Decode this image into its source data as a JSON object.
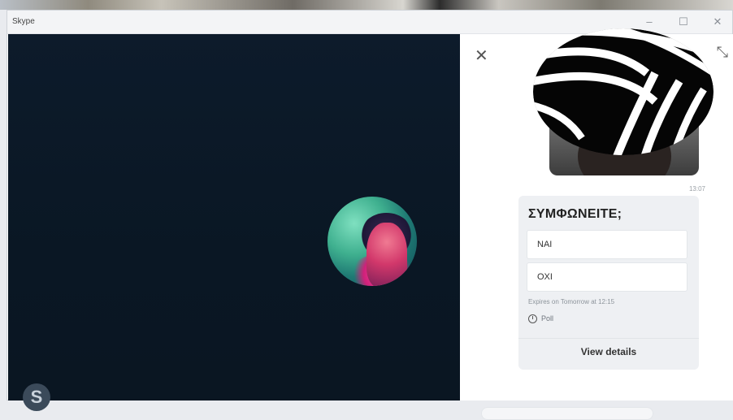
{
  "window": {
    "title": "Skype",
    "minimize_symbol": "–",
    "maximize_symbol": "☐",
    "close_symbol": "✕"
  },
  "call": {
    "background_color": "#0c1a29",
    "brand_icon": "skype-logo-icon",
    "brand_letter": "S"
  },
  "side_panel": {
    "close_symbol": "✕",
    "expand_symbol": "⤡",
    "message_time": "13:07",
    "poll": {
      "question": "ΣΥΜΦΩΝΕΙΤΕ;",
      "options": [
        "NAI",
        "OXI"
      ],
      "expiry": "Expires on Tomorrow at 12:15",
      "status": "Poll",
      "details_label": "View details"
    }
  }
}
